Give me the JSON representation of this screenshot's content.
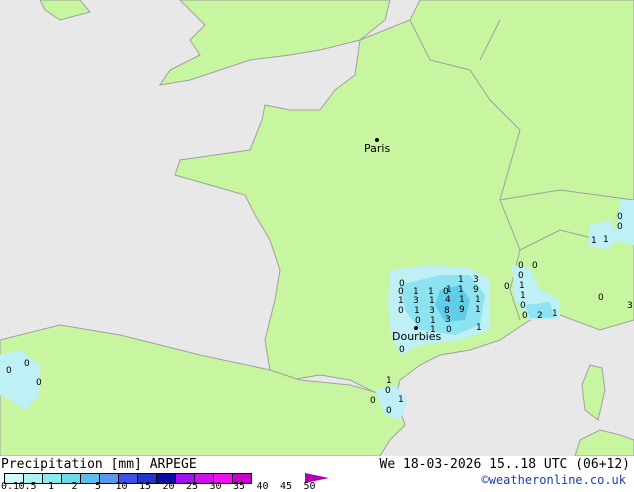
{
  "map": {
    "colors": {
      "sea": "#e8e8e8",
      "land": "#c8f5a0",
      "border": "#a0a0a0",
      "rain_light": "#bff0f5",
      "rain_mid": "#8ee3f0",
      "rain_heavy": "#62cde8"
    },
    "cities": [
      "Paris",
      "Dourbies"
    ],
    "values": [
      "0",
      "1",
      "1",
      "3",
      "0",
      "1",
      "0",
      "1",
      "1",
      "9",
      "1",
      "3",
      "1",
      "4",
      "1",
      "1",
      "0",
      "1",
      "3",
      "8",
      "9",
      "1",
      "0",
      "1",
      "1",
      "3",
      "0",
      "1",
      "0",
      "0",
      "0",
      "0",
      "1",
      "1",
      "0",
      "0",
      "2",
      "1",
      "0",
      "1",
      "1",
      "0",
      "0",
      "3",
      "0",
      "1",
      "0",
      "1",
      "0",
      "0",
      "0",
      "0",
      "0"
    ]
  },
  "legend": {
    "title": "Precipitation [mm]  ARPEGE",
    "datetime": "We 18-03-2026 15..18 UTC (06+12)",
    "credit": "©weatheronline.co.uk",
    "ticks": [
      "0.1",
      "0.5",
      "1",
      "2",
      "5",
      "10",
      "15",
      "20",
      "25",
      "30",
      "35",
      "40",
      "45",
      "50"
    ],
    "colors": [
      "#d2f8f8",
      "#a8f5f5",
      "#8ceaea",
      "#6cd8ec",
      "#5cbcec",
      "#5a98ec",
      "#3c50e8",
      "#2434c8",
      "#0c0ca0",
      "#a010ec",
      "#d010ec",
      "#f010f0",
      "#c800c8"
    ]
  }
}
